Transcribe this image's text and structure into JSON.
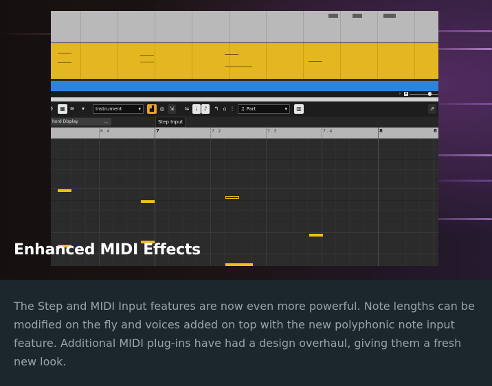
{
  "hero": {
    "title": "Enhanced MIDI Effects"
  },
  "editor": {
    "instrument_combo": "Instrument",
    "part_combo": "Part",
    "tooltip": "Step Input",
    "chord_display": "hord Display",
    "chord_menu": "...",
    "ruler_labels": [
      "6 . 4",
      "7",
      "7 . 2",
      "7 . 3",
      "7 . 4",
      "8",
      "8"
    ]
  },
  "description": {
    "text": "The Step and MIDI Input features are now even more powerful. Note lengths can be modified on the fly and voices added on top with the new polyphonic note input feature. Additional MIDI plug-ins have had a design overhaul, giving them a fresh new look."
  },
  "colors": {
    "accent_yellow": "#e4b720",
    "note_yellow": "#f0be1c",
    "track_blue": "#2f83d6",
    "page_bg": "#1b262d",
    "body_text": "#9aa3aa"
  }
}
